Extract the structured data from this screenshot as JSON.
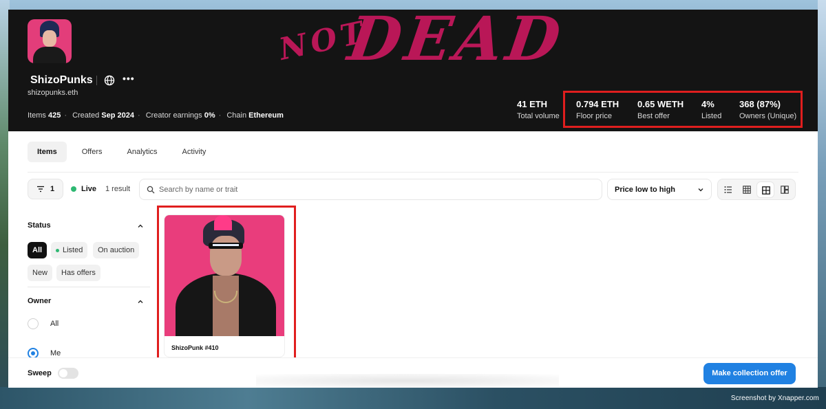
{
  "collection": {
    "name": "ShizoPunks",
    "ens": "shizopunks.eth",
    "meta": [
      {
        "label": "Items",
        "value": "425"
      },
      {
        "label": "Created",
        "value": "Sep 2024"
      },
      {
        "label": "Creator earnings",
        "value": "0%"
      },
      {
        "label": "Chain",
        "value": "Ethereum"
      }
    ],
    "banner_text_1": "NOT",
    "banner_text_2": "DEAD"
  },
  "stats": [
    {
      "value": "41 ETH",
      "label": "Total volume"
    },
    {
      "value": "0.794 ETH",
      "label": "Floor price"
    },
    {
      "value": "0.65 WETH",
      "label": "Best offer"
    },
    {
      "value": "4%",
      "label": "Listed"
    },
    {
      "value": "368 (87%)",
      "label": "Owners (Unique)"
    }
  ],
  "tabs": [
    "Items",
    "Offers",
    "Analytics",
    "Activity"
  ],
  "toolbar": {
    "filter_count": "1",
    "live_label": "Live",
    "result_text": "1 result",
    "search_placeholder": "Search by name or trait",
    "sort_label": "Price low to high"
  },
  "filters": {
    "status_title": "Status",
    "status_chips": [
      "All",
      "Listed",
      "On auction",
      "New",
      "Has offers"
    ],
    "owner_title": "Owner",
    "owner_options": [
      "All",
      "Me"
    ]
  },
  "items": [
    {
      "name": "ShizoPunk #410"
    }
  ],
  "bottom": {
    "sweep_label": "Sweep",
    "offer_button": "Make collection offer"
  },
  "credit": "Screenshot by Xnapper.com",
  "colors": {
    "accent": "#2081e2",
    "live": "#2eb872",
    "highlight": "#e01e1e",
    "banner_text": "#c2185b"
  }
}
